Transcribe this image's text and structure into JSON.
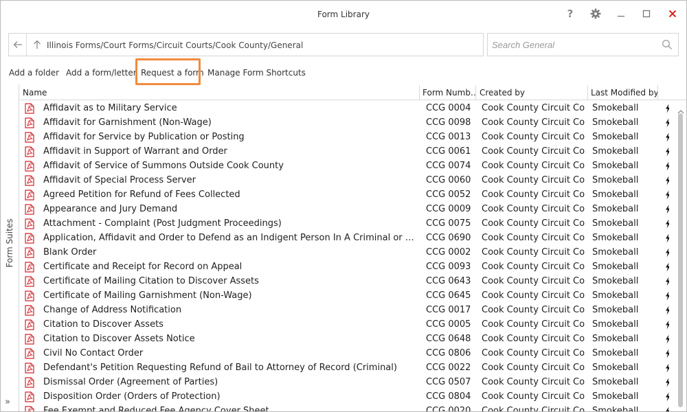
{
  "window": {
    "title": "Form Library"
  },
  "colors": {
    "accent_highlight": "#f08a3c",
    "close_icon": "#d9261c",
    "pdf_icon": "#d4252b"
  },
  "titlebar": {
    "help_label": "?",
    "icons": [
      "help-icon",
      "gear-icon",
      "minimize-icon",
      "maximize-icon",
      "close-icon"
    ]
  },
  "address": {
    "path": "Illinois Forms/Court Forms/Circuit Courts/Cook County/General",
    "icons": [
      "back-arrow-icon",
      "up-arrow-icon"
    ]
  },
  "search": {
    "placeholder": "Search General",
    "value": ""
  },
  "toolbar": {
    "add_folder": "Add a folder",
    "add_form": "Add a form/letter",
    "request_form": "Request a form",
    "manage_shortcuts": "Manage Form Shortcuts"
  },
  "rail": {
    "label": "Form Suites",
    "expand_glyph": "»"
  },
  "table": {
    "columns": {
      "name": "Name",
      "number": "Form Numb…",
      "created": "Created by",
      "modified": "Last Modified by"
    },
    "rows": [
      {
        "name": "Affidavit as to Military Service",
        "number": "CCG 0004",
        "created": "Cook County Circuit Co...",
        "modified": "Smokeball"
      },
      {
        "name": "Affidavit for Garnishment (Non-Wage)",
        "number": "CCG 0098",
        "created": "Cook County Circuit Co...",
        "modified": "Smokeball"
      },
      {
        "name": "Affidavit for Service by Publication or Posting",
        "number": "CCG 0013",
        "created": "Cook County Circuit Co...",
        "modified": "Smokeball"
      },
      {
        "name": "Affidavit in Support of Warrant and Order",
        "number": "CCG 0061",
        "created": "Cook County Circuit Co...",
        "modified": "Smokeball"
      },
      {
        "name": "Affidavit of Service of Summons Outside Cook County",
        "number": "CCG 0074",
        "created": "Cook County Circuit Co...",
        "modified": "Smokeball"
      },
      {
        "name": "Affidavit of Special Process Server",
        "number": "CCG 0060",
        "created": "Cook County Circuit Co...",
        "modified": "Smokeball"
      },
      {
        "name": "Agreed Petition for Refund of Fees Collected",
        "number": "CCG 0052",
        "created": "Cook County Circuit Co...",
        "modified": "Smokeball"
      },
      {
        "name": "Appearance and Jury Demand",
        "number": "CCG 0009",
        "created": "Cook County Circuit Co...",
        "modified": "Smokeball"
      },
      {
        "name": "Attachment - Complaint (Post Judgment Proceedings)",
        "number": "CCG 0075",
        "created": "Cook County Circuit Co...",
        "modified": "Smokeball"
      },
      {
        "name": "Application, Affidavit and Order to Defend as an Indigent Person In A Criminal or Traffic Mat...",
        "number": "CCG 0690",
        "created": "Cook County Circuit Co...",
        "modified": "Smokeball"
      },
      {
        "name": "Blank Order",
        "number": "CCG 0002",
        "created": "Cook County Circuit Co...",
        "modified": "Smokeball"
      },
      {
        "name": "Certificate and Receipt for Record on Appeal",
        "number": "CCG 0093",
        "created": "Cook County Circuit Co...",
        "modified": "Smokeball"
      },
      {
        "name": "Certificate of Mailing Citation to Discover Assets",
        "number": "CCG 0643",
        "created": "Cook County Circuit Co...",
        "modified": "Smokeball"
      },
      {
        "name": "Certificate of Mailing Garnishment (Non-Wage)",
        "number": "CCG 0645",
        "created": "Cook County Circuit Co...",
        "modified": "Smokeball"
      },
      {
        "name": "Change of Address Notification",
        "number": "CCG 0017",
        "created": "Cook County Circuit Co...",
        "modified": "Smokeball"
      },
      {
        "name": "Citation to Discover Assets",
        "number": "CCG 0005",
        "created": "Cook County Circuit Co...",
        "modified": "Smokeball"
      },
      {
        "name": "Citation to Discover Assets Notice",
        "number": "CCG 0648",
        "created": "Cook County Circuit Co...",
        "modified": "Smokeball"
      },
      {
        "name": "Civil No Contact Order",
        "number": "CCG 0806",
        "created": "Cook County Circuit Co...",
        "modified": "Smokeball"
      },
      {
        "name": "Defendant's Petition Requesting Refund of Bail to Attorney of Record (Criminal)",
        "number": "CCG 0022",
        "created": "Cook County Circuit Co...",
        "modified": "Smokeball"
      },
      {
        "name": "Dismissal Order (Agreement of Parties)",
        "number": "CCG 0507",
        "created": "Cook County Circuit Co...",
        "modified": "Smokeball"
      },
      {
        "name": "Disposition Order (Orders of Protection)",
        "number": "CCG 0804",
        "created": "Cook County Circuit Co...",
        "modified": "Smokeball"
      },
      {
        "name": "Fee Exempt and Reduced Fee Agency Cover Sheet",
        "number": "CCG 0020",
        "created": "Cook County Circuit Co...",
        "modified": "Smokeball"
      }
    ]
  }
}
